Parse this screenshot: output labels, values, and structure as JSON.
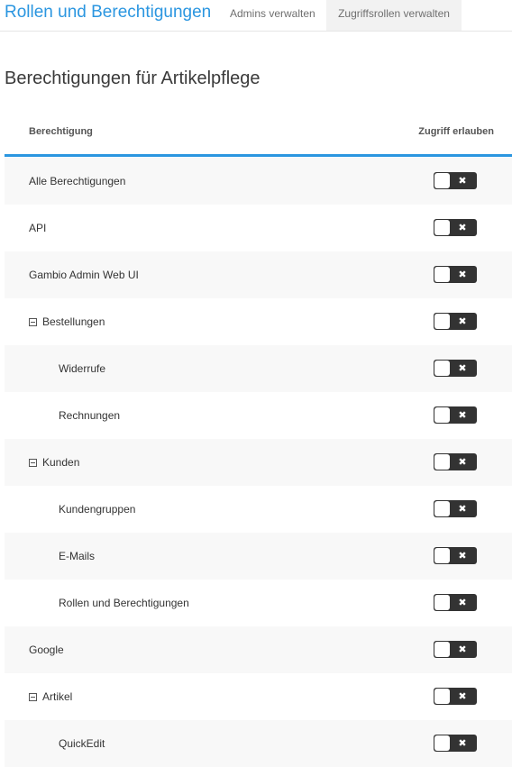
{
  "header": {
    "app_title": "Rollen und Berechtigungen",
    "tabs": [
      {
        "label": "Admins verwalten",
        "active": false
      },
      {
        "label": "Zugriffsrollen verwalten",
        "active": true
      }
    ]
  },
  "page": {
    "title": "Berechtigungen für Artikelpflege"
  },
  "table": {
    "columns": [
      "Berechtigung",
      "Zugriff erlauben"
    ],
    "rows": [
      {
        "label": "Alle Berechtigungen",
        "level": 0,
        "collapsible": false,
        "access": false
      },
      {
        "label": "API",
        "level": 0,
        "collapsible": false,
        "access": false
      },
      {
        "label": "Gambio Admin Web UI",
        "level": 0,
        "collapsible": false,
        "access": false
      },
      {
        "label": "Bestellungen",
        "level": 0,
        "collapsible": true,
        "access": false
      },
      {
        "label": "Widerrufe",
        "level": 1,
        "collapsible": false,
        "access": false
      },
      {
        "label": "Rechnungen",
        "level": 1,
        "collapsible": false,
        "access": false
      },
      {
        "label": "Kunden",
        "level": 0,
        "collapsible": true,
        "access": false
      },
      {
        "label": "Kundengruppen",
        "level": 1,
        "collapsible": false,
        "access": false
      },
      {
        "label": "E-Mails",
        "level": 1,
        "collapsible": false,
        "access": false
      },
      {
        "label": "Rollen und Berechtigungen",
        "level": 1,
        "collapsible": false,
        "access": false
      },
      {
        "label": "Google",
        "level": 0,
        "collapsible": false,
        "access": false
      },
      {
        "label": "Artikel",
        "level": 0,
        "collapsible": true,
        "access": false
      },
      {
        "label": "QuickEdit",
        "level": 1,
        "collapsible": false,
        "access": false
      }
    ]
  },
  "icons": {
    "collapse": "minus-square-icon",
    "toggle_off": "close-icon"
  },
  "colors": {
    "accent": "#2b96e0",
    "toggle_bg": "#333333",
    "row_alt": "#f8f8f8"
  }
}
